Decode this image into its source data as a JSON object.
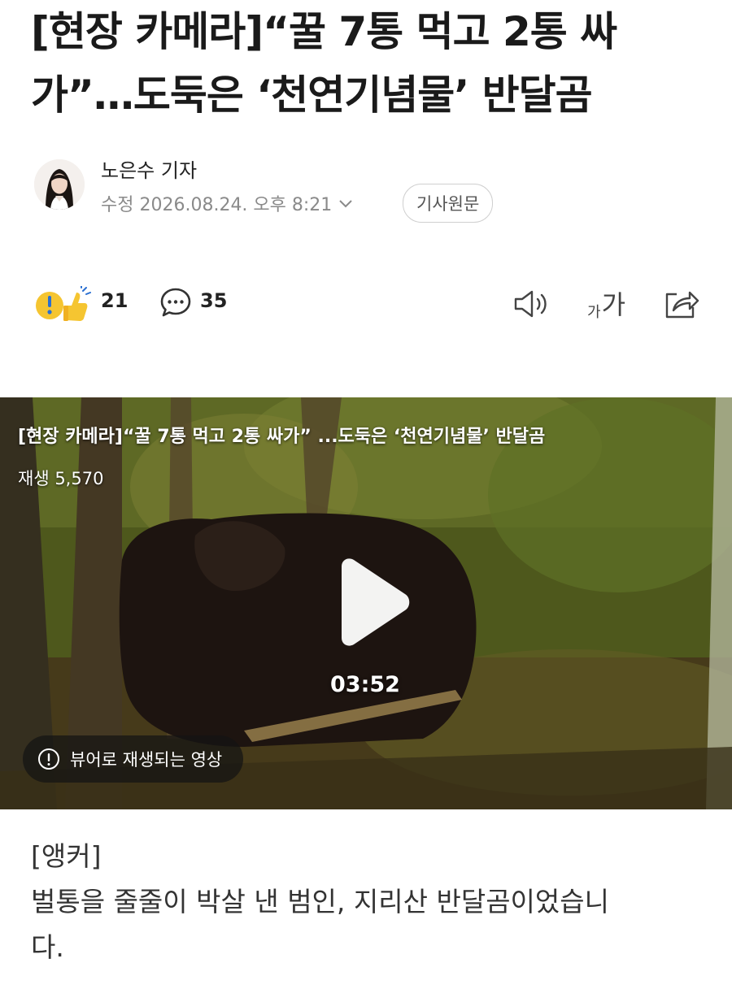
{
  "article": {
    "title_line1": "[현장 카메라]“꿀 7통 먹고 2통 싸",
    "title_line2": "가”…도둑은 ‘천연기념물’ 반달곰",
    "reporter": "노은수 기자",
    "date": "수정 2026.08.24. 오후 8:21",
    "original_button": "기사원문"
  },
  "toolbar": {
    "reaction_count": "21",
    "comment_count": "35",
    "font_size_small": "가",
    "font_size_large": "가"
  },
  "video": {
    "title": "[현장 카메라]“꿀 7통 먹고 2통 싸가” ...도둑은 ‘천연기념물’ 반달곰",
    "views": "재생 5,570",
    "duration": "03:52",
    "viewer_notice": "뷰어로 재생되는 영상"
  },
  "content": {
    "paragraph1": "[앵커]",
    "paragraph2": "벌통을 줄줄이 박살 낸 범인, 지리산 반달곰이었습니",
    "paragraph3": "다."
  },
  "colors": {
    "accent_yellow": "#f5c531",
    "text_dark": "#1a1a1a",
    "meta_gray": "#8a8a8a"
  },
  "icons": [
    "reaction-icon",
    "comment-icon",
    "speaker-icon",
    "font-size-icon",
    "share-icon",
    "play-icon",
    "info-icon",
    "chevron-down-icon"
  ]
}
